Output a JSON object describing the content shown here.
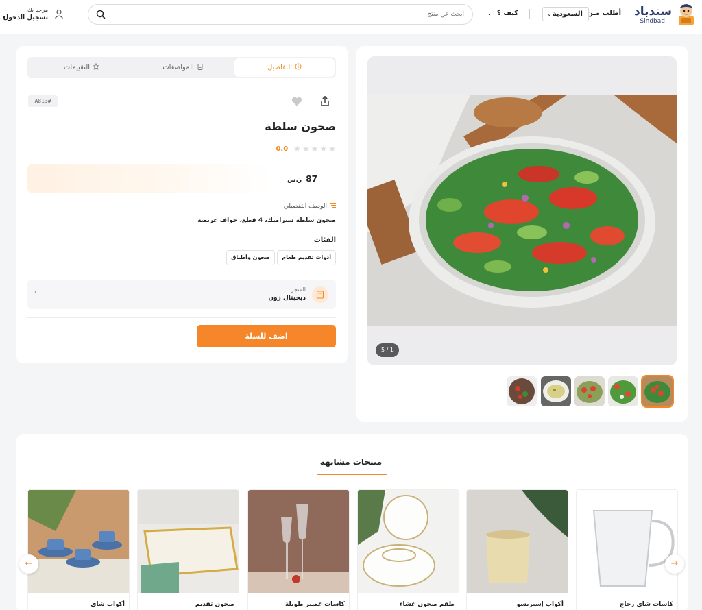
{
  "header": {
    "logo_ar": "سندباد",
    "logo_en": "Sindbad",
    "order_from": "أطلب مـن",
    "country": "السعودية",
    "how": "كيف ؟",
    "search_placeholder": "ابحث عن منتج",
    "greeting": "مرحبا بك",
    "signin": "تسجيل الدخول"
  },
  "tabs": [
    {
      "label": "التفاصيل",
      "icon": "info-icon"
    },
    {
      "label": "المواصفات",
      "icon": "clipboard-icon"
    },
    {
      "label": "التقييمات",
      "icon": "star-icon"
    }
  ],
  "product": {
    "sku": "A813#",
    "title": "صحون سلطة",
    "rating_value": "0.0",
    "rating_stars": 0,
    "price": "87",
    "currency": "ر.س",
    "description_label": "الوصف التفصيلي",
    "description": "صحون سلطة سيراميك، 4 قطع، حواف عريضة",
    "categories_label": "الفئات",
    "categories": [
      "أدوات تقديم طعام",
      "صحون وأطباق"
    ],
    "store_label": "المتجر",
    "store_name": "ديجيتال زون",
    "add_to_cart": "اضف للسلة"
  },
  "gallery": {
    "counter": "5 / 1",
    "thumbnails": 5,
    "active_thumbnail": 1
  },
  "similar": {
    "title": "منتجات مشابهة",
    "products": [
      {
        "name": "كاسات شاي زجاج"
      },
      {
        "name": "أكواب إسبريسو"
      },
      {
        "name": "طقم صحون عشاء"
      },
      {
        "name": "كاسات عصير طويلة"
      },
      {
        "name": "صحون تقديم"
      },
      {
        "name": "أكواب شاي"
      }
    ]
  },
  "colors": {
    "accent": "#f6862a",
    "logo_blue": "#2c3e6e"
  }
}
